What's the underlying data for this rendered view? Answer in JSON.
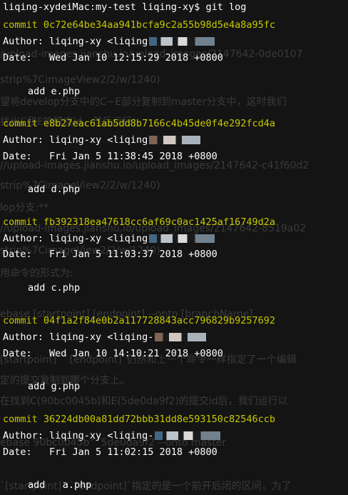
{
  "background_text": [
    "/upload-images.jianshu.io/upload_images/2147642-0de0107",
    "strip%7CimageView2/2/w/1240)",
    "望将develop分支中的C~E部分复制到master分支中，这时我们",
    "找出C和E的提交id，然后运行：",
    "//upload-images.jianshu.io/upload_images/2147642-c41f60d2",
    "strip%7CimageView2/2/w/1240)",
    "lop分支:**",
    "//upload-images.jianshu.io/upload_images/2147642-8519a02",
    "strip%7CimageView2/2/w/1240)",
    "用命令的形式为:",
    "ebase [startpoint] [endpoint] --onto [branchName]",
    "[startpoint]` `[endpoint]`仍然和上一个命令一样指定了一个编辑",
    "定的提交复制到哪个分支上。",
    "在找到C(90bc0045b)和E(5de0da9f2)的提交id后，我们运行以",
    "ebase 90bc0045b^ 5de0da9f2 --onto master",
    "`[startpoint]` `[endpoint]`指定的是一个前开后闭的区间，为了"
  ],
  "terminal": {
    "prompt": "liqing-xydeiMac:my-test liqing-xy$ git log",
    "commits": [
      {
        "hash_line": "commit 0c72e64be34aa941bcfa9c2a55b98d5e4a8a95fc",
        "author": "Author: liqing-xy <liqing",
        "date": "Date:   Wed Jan 10 12:15:29 2018 +0800",
        "message": "add e.php"
      },
      {
        "hash_line": "commit e8b27eac61ab5dd8b7166c4b45de0f4e292fcd4a",
        "author": "Author: liqing-xy <liqing",
        "date": "Date:   Fri Jan 5 11:38:45 2018 +0800",
        "message": "add d.php"
      },
      {
        "hash_line": "commit fb392318ea47618cc6af69c0ac1425af16749d2a",
        "author": "Author: liqing-xy <liqing",
        "date": "Date:   Fri Jan 5 11:03:37 2018 +0800",
        "message": "add c.php"
      },
      {
        "hash_line": "commit 04f1a2f84e0b2a117728843acc796829b9257692",
        "author": "Author: liqing-xy <liqing-",
        "date": "Date:   Wed Jan 10 14:10:21 2018 +0800",
        "message": "add g.php"
      },
      {
        "hash_line": "commit 36224db00a81dd72bbb31dd8e593150c82546ccb",
        "author": "Author: liqing-xy <liqing-",
        "date": "Date:   Fri Jan 5 11:02:15 2018 +0800",
        "message": "add   a.php"
      }
    ]
  }
}
